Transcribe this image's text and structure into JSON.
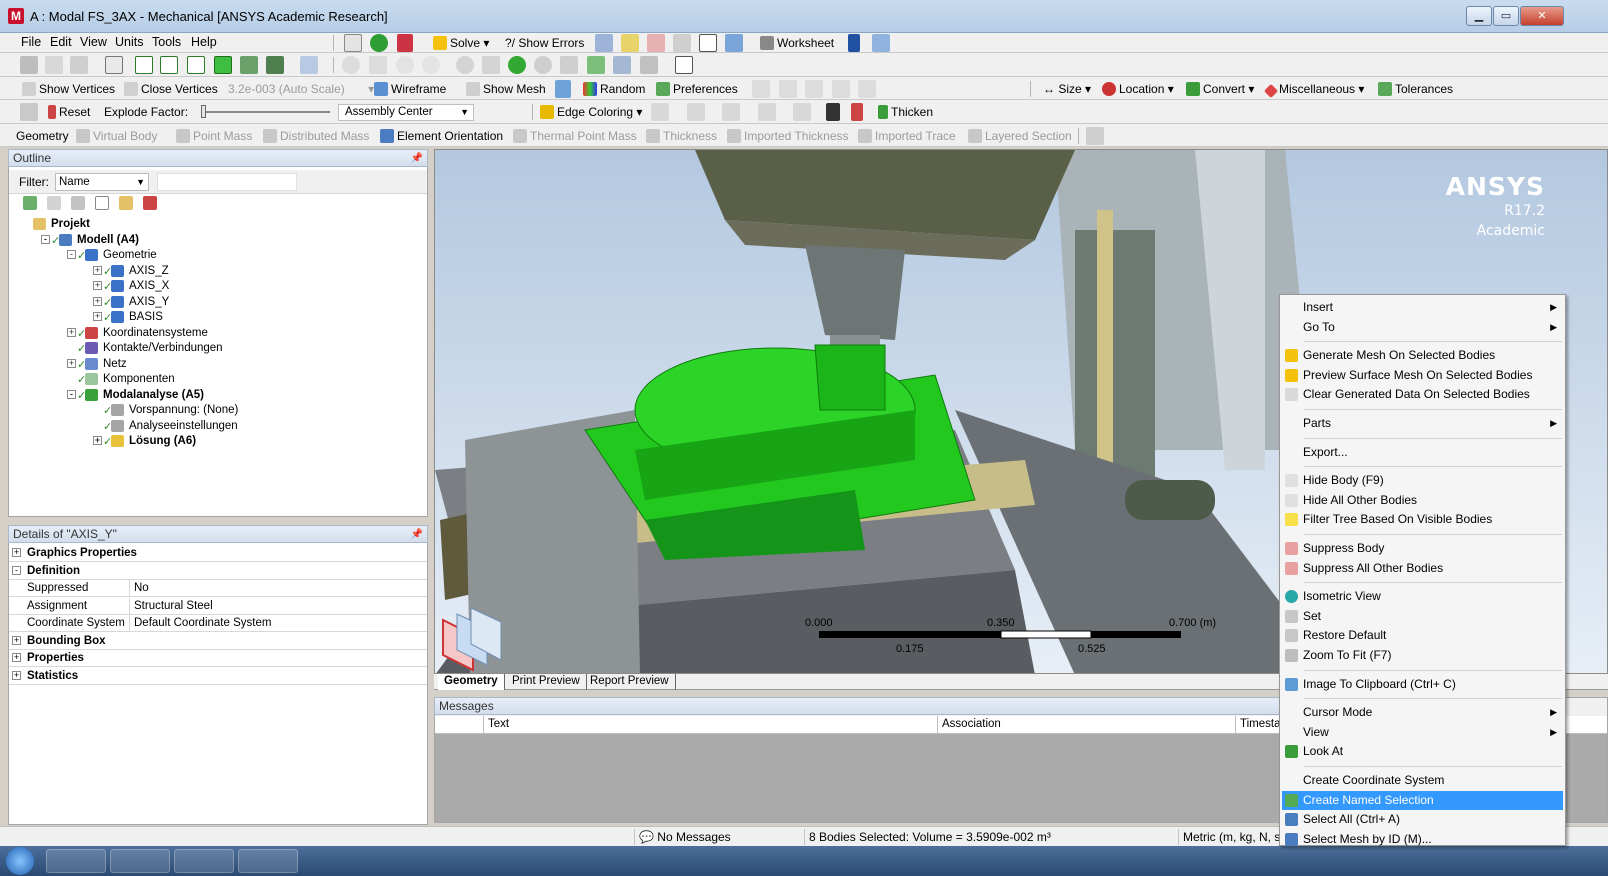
{
  "window": {
    "title": "A : Modal FS_3AX - Mechanical [ANSYS Academic Research]",
    "app_icon_letter": "M",
    "controls": {
      "minimize": "▁",
      "maximize": "▭",
      "close": "✕"
    }
  },
  "menubar": {
    "items": [
      "File",
      "Edit",
      "View",
      "Units",
      "Tools",
      "Help"
    ]
  },
  "toolbar_main": {
    "solve": "Solve",
    "show_errors": "Show Errors",
    "worksheet": "Worksheet"
  },
  "toolbar_display": {
    "show_vertices": "Show Vertices",
    "close_vertices": "Close Vertices",
    "auto_scale": "3.2e-003 (Auto Scale)",
    "wireframe": "Wireframe",
    "show_mesh": "Show Mesh",
    "random": "Random",
    "preferences": "Preferences",
    "size": "Size",
    "location": "Location",
    "convert": "Convert",
    "miscellaneous": "Miscellaneous",
    "tolerances": "Tolerances"
  },
  "toolbar_explode": {
    "reset": "Reset",
    "explode_factor": "Explode Factor:",
    "assembly_center": "Assembly Center",
    "edge_coloring": "Edge Coloring",
    "thicken": "Thicken"
  },
  "toolbar_context": {
    "geometry": "Geometry",
    "virtual_body": "Virtual Body",
    "point_mass": "Point Mass",
    "distributed_mass": "Distributed Mass",
    "element_orientation": "Element Orientation",
    "thermal_point_mass": "Thermal Point Mass",
    "thickness": "Thickness",
    "imported_thickness": "Imported Thickness",
    "imported_trace": "Imported Trace",
    "layered_section": "Layered Section"
  },
  "outline": {
    "header": "Outline",
    "filter_label": "Filter:",
    "filter_value": "Name",
    "tree": [
      {
        "label": "Projekt",
        "level": 0,
        "bold": true,
        "exp": ""
      },
      {
        "label": "Modell (A4)",
        "level": 1,
        "bold": true,
        "exp": "-"
      },
      {
        "label": "Geometrie",
        "level": 2,
        "bold": false,
        "exp": "-"
      },
      {
        "label": "AXIS_Z",
        "level": 3,
        "bold": false,
        "exp": "+"
      },
      {
        "label": "AXIS_X",
        "level": 3,
        "bold": false,
        "exp": "+"
      },
      {
        "label": "AXIS_Y",
        "level": 3,
        "bold": false,
        "exp": "+"
      },
      {
        "label": "BASIS",
        "level": 3,
        "bold": false,
        "exp": "+"
      },
      {
        "label": "Koordinatensysteme",
        "level": 2,
        "bold": false,
        "exp": "+"
      },
      {
        "label": "Kontakte/Verbindungen",
        "level": 2,
        "bold": false,
        "exp": ""
      },
      {
        "label": "Netz",
        "level": 2,
        "bold": false,
        "exp": "+"
      },
      {
        "label": "Komponenten",
        "level": 2,
        "bold": false,
        "exp": ""
      },
      {
        "label": "Modalanalyse (A5)",
        "level": 2,
        "bold": true,
        "exp": "-"
      },
      {
        "label": "Vorspannung: (None)",
        "level": 3,
        "bold": false,
        "exp": ""
      },
      {
        "label": "Analyseeinstellungen",
        "level": 3,
        "bold": false,
        "exp": ""
      },
      {
        "label": "Lösung (A6)",
        "level": 3,
        "bold": true,
        "exp": "+"
      }
    ]
  },
  "details": {
    "header": "Details of \"AXIS_Y\"",
    "rows": [
      {
        "type": "group",
        "label": "Graphics Properties",
        "exp": "+"
      },
      {
        "type": "group",
        "label": "Definition",
        "exp": "-"
      },
      {
        "type": "prop",
        "key": "Suppressed",
        "value": "No"
      },
      {
        "type": "prop",
        "key": "Assignment",
        "value": "Structural Steel"
      },
      {
        "type": "prop",
        "key": "Coordinate System",
        "value": "Default Coordinate System"
      },
      {
        "type": "group",
        "label": "Bounding Box",
        "exp": "+"
      },
      {
        "type": "group",
        "label": "Properties",
        "exp": "+"
      },
      {
        "type": "group",
        "label": "Statistics",
        "exp": "+"
      }
    ]
  },
  "viewport": {
    "logo": {
      "brand": "ANSYS",
      "version": "R17.2",
      "edition": "Academic"
    },
    "scale": {
      "top_labels": [
        "0.000",
        "0.350",
        "0.700 (m)"
      ],
      "bottom_labels": [
        "0.175",
        "0.525"
      ]
    }
  },
  "view_tabs": [
    "Geometry",
    "Print Preview",
    "Report Preview"
  ],
  "messages": {
    "header": "Messages",
    "columns": [
      "Text",
      "Association",
      "Timesta"
    ]
  },
  "status": {
    "messages": "No Messages",
    "selection": "8 Bodies Selected: Volume = 3.5909e-002 m³",
    "units": "Metric (m, kg, N, s"
  },
  "context_menu": {
    "items": [
      {
        "label": "Insert",
        "submenu": true
      },
      {
        "label": "Go To",
        "submenu": true
      },
      {
        "sep": true
      },
      {
        "label": "Generate Mesh On Selected Bodies",
        "icon": "lightning-icon"
      },
      {
        "label": "Preview Surface Mesh On Selected Bodies",
        "icon": "lightning-icon"
      },
      {
        "label": "Clear Generated Data On Selected Bodies",
        "icon": "clear-data-icon"
      },
      {
        "sep": true
      },
      {
        "label": "Parts",
        "submenu": true
      },
      {
        "sep": true
      },
      {
        "label": "Export..."
      },
      {
        "sep": true
      },
      {
        "label": "Hide Body (F9)",
        "icon": "bulb-off-icon"
      },
      {
        "label": "Hide All Other Bodies",
        "icon": "bulb-off-icon"
      },
      {
        "label": "Filter Tree Based On Visible Bodies",
        "icon": "bulb-on-icon"
      },
      {
        "sep": true
      },
      {
        "label": "Suppress Body",
        "icon": "suppress-icon"
      },
      {
        "label": "Suppress All Other Bodies",
        "icon": "suppress-icon"
      },
      {
        "sep": true
      },
      {
        "label": "Isometric View",
        "icon": "isometric-icon"
      },
      {
        "label": "Set",
        "icon": "iso-set-icon"
      },
      {
        "label": "Restore Default",
        "icon": "iso-restore-icon"
      },
      {
        "label": "Zoom To Fit (F7)",
        "icon": "zoom-fit-icon"
      },
      {
        "sep": true
      },
      {
        "label": "Image To Clipboard (Ctrl+ C)",
        "icon": "camera-icon"
      },
      {
        "sep": true
      },
      {
        "label": "Cursor Mode",
        "submenu": true
      },
      {
        "label": "View",
        "submenu": true
      },
      {
        "label": "Look At",
        "icon": "look-at-icon"
      },
      {
        "sep": true
      },
      {
        "label": "Create Coordinate System"
      },
      {
        "label": "Create Named Selection",
        "icon": "named-selection-icon",
        "highlight": true
      },
      {
        "label": "Select All (Ctrl+ A)",
        "icon": "select-all-icon"
      },
      {
        "label": "Select Mesh by ID (M)...",
        "icon": "select-mesh-icon"
      }
    ]
  },
  "colors": {
    "selection_green": "#22c81e",
    "menu_highlight": "#3399ff",
    "viewport_top": "#b3c8e0",
    "viewport_bottom": "#e7eef6"
  }
}
